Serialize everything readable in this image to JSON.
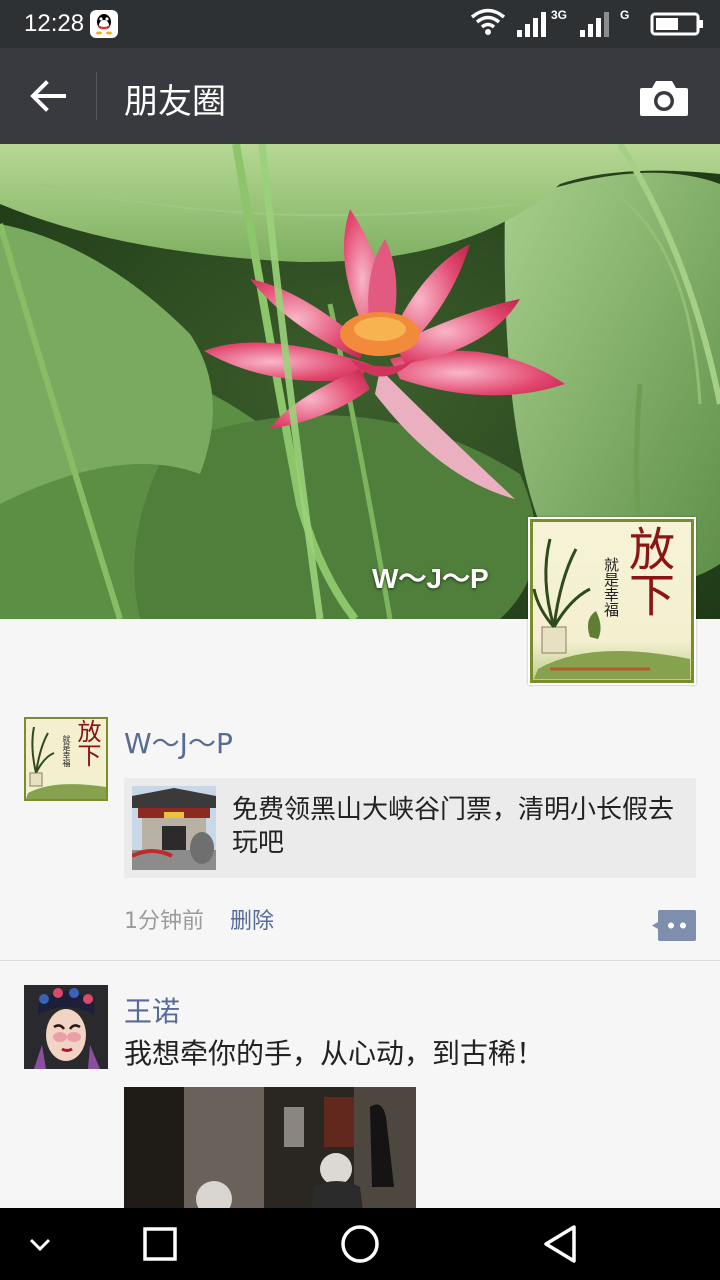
{
  "status_bar": {
    "time": "12:28",
    "network_primary": "3G",
    "network_secondary": "G"
  },
  "toolbar": {
    "title": "朋友圈"
  },
  "cover": {
    "user_name": "W～J～P",
    "avatar_text_main": "放下",
    "avatar_text_sub": "就是幸福"
  },
  "posts": [
    {
      "author": "W～J～P",
      "avatar_text_main": "放下",
      "avatar_text_sub": "就是幸福",
      "link_title": "免费领黑山大峡谷门票，清明小长假去玩吧",
      "time": "1分钟前",
      "delete_label": "删除"
    },
    {
      "author": "王诺",
      "text": "我想牵你的手，从心动，到古稀！"
    }
  ],
  "colors": {
    "toolbar_bg": "#393a3f",
    "status_bg": "#2e3134",
    "nick_color": "#576b95",
    "feed_bg": "#f6f6f6"
  },
  "icons": {
    "back": "arrow-left-icon",
    "camera": "camera-icon",
    "comment": "comment-icon",
    "nav_down": "chevron-down-icon",
    "nav_recent": "square-icon",
    "nav_home": "circle-icon",
    "nav_back": "triangle-back-icon"
  }
}
